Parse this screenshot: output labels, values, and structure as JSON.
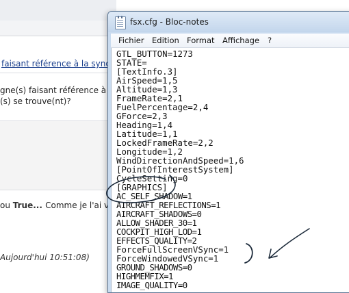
{
  "background_page": {
    "line1_link": "faisant référence à la synd",
    "line2": "gne(s) faisant référence à la",
    "line3": "(s) se trouve(nt)?",
    "line4_prefix": "ou ",
    "line4_bold1": "True",
    "line4_sep": "... ",
    "line4_suffix": " Comme je l'ai v",
    "line5": "Aujourd'hui 10:51:08)"
  },
  "notepad": {
    "title": "fsx.cfg - Bloc-notes",
    "icon": "notepad-icon",
    "menu": [
      "Fichier",
      "Edition",
      "Format",
      "Affichage",
      "?"
    ],
    "lines": [
      "GTL_BUTTON=1273",
      "STATE=",
      "[TextInfo.3]",
      "AirSpeed=1,5",
      "Altitude=1,3",
      "FrameRate=2,1",
      "FuelPercentage=2,4",
      "GForce=2,3",
      "Heading=1,4",
      "Latitude=1,1",
      "LockedFrameRate=2,2",
      "Longitude=1,2",
      "WindDirectionAndSpeed=1,6",
      "[PointOfInterestSystem]",
      "CycleSetting=0",
      "[GRAPHICS]",
      "AC_SELF_SHADOW=1",
      "AIRCRAFT_REFLECTIONS=1",
      "AIRCRAFT_SHADOWS=0",
      "ALLOW_SHADER_30=1",
      "COCKPIT_HIGH_LOD=1",
      "EFFECTS_QUALITY=2",
      "ForceFullScreenVSync=1",
      "ForceWindowedVSync=1",
      "GROUND_SHADOWS=0",
      "HIGHMEMFIX=1",
      "IMAGE_QUALITY=0"
    ]
  },
  "annotation_colors": {
    "ink": "#1c2a3a"
  }
}
